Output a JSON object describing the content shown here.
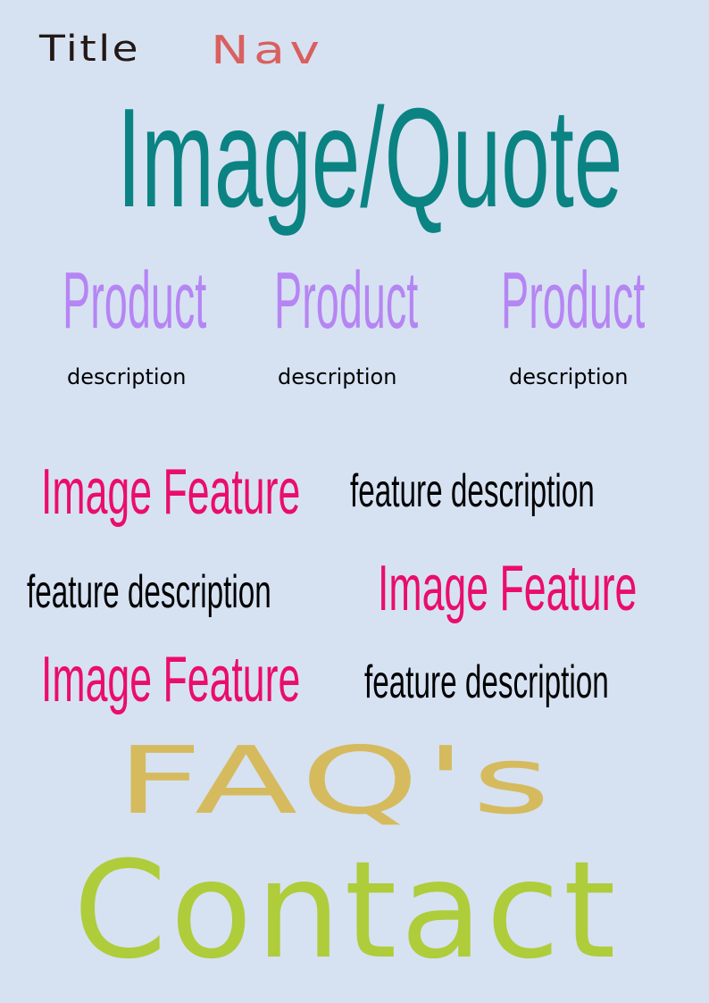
{
  "header": {
    "title": "Title",
    "nav": "Nav"
  },
  "hero": {
    "text": "Image/Quote"
  },
  "products": [
    {
      "name": "Product",
      "description": "description"
    },
    {
      "name": "Product",
      "description": "description"
    },
    {
      "name": "Product",
      "description": "description"
    }
  ],
  "features": {
    "rows": [
      {
        "image": "Image Feature",
        "description": "feature description"
      },
      {
        "image": "Image Feature",
        "description": "feature description"
      },
      {
        "image": "Image Feature",
        "description": "feature description"
      }
    ]
  },
  "faq": {
    "label": "FAQ's"
  },
  "contact": {
    "label": "Contact"
  },
  "colors": {
    "background": "#d6e2f2",
    "title": "#231815",
    "nav": "#d9605f",
    "hero": "#0b8383",
    "product": "#b685f4",
    "description": "#000000",
    "feature_image": "#ea0d6b",
    "faq": "#d5bb5e",
    "contact": "#afcc3b"
  }
}
